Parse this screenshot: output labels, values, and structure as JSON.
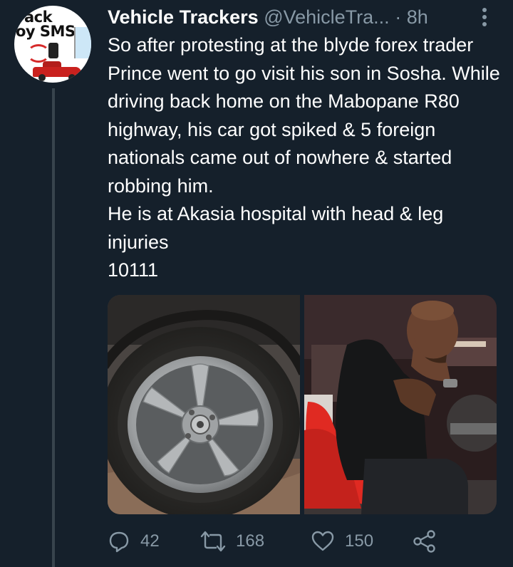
{
  "author": {
    "display_name": "Vehicle Trackers",
    "handle": "@VehicleTra...",
    "separator": "·",
    "time": "8h",
    "avatar_text_line1": "ack",
    "avatar_text_line2": "oy SMS"
  },
  "tweet": {
    "paragraphs": [
      "So after protesting at the blyde forex trader Prince went to go visit his son in Sosha. While driving back home on the Mabopane R80 highway, his car got spiked & 5 foreign nationals came out of nowhere & started robbing him.",
      "He is at Akasia hospital with head & leg injuries",
      "10111"
    ]
  },
  "media": [
    {
      "subject": "damaged alloy wheel with deflated tyre"
    },
    {
      "subject": "man seated on red chair, hand under chin"
    }
  ],
  "actions": {
    "reply_count": "42",
    "retweet_count": "168",
    "like_count": "150"
  },
  "icons": {
    "reply": "reply-icon",
    "retweet": "retweet-icon",
    "like": "heart-icon",
    "share": "share-icon",
    "more": "more-vertical-icon"
  },
  "colors": {
    "background": "#15202b",
    "text": "#ffffff",
    "secondary_text": "#8899a6",
    "thread_line": "#38444d"
  }
}
